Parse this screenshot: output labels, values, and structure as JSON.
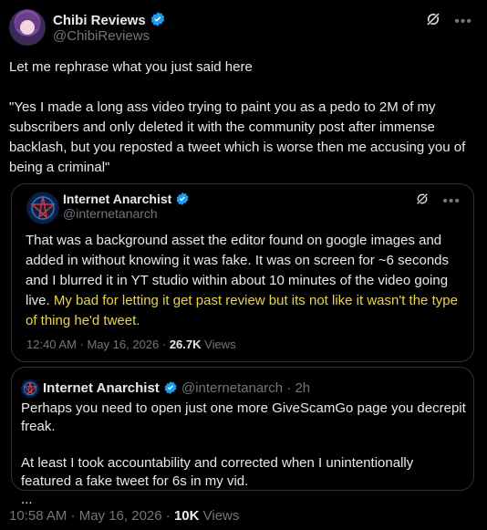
{
  "main_tweet": {
    "author_name": "Chibi Reviews",
    "author_handle": "@ChibiReviews",
    "text": "Let me rephrase what you just said here\n\n\"Yes I made a long ass video trying to paint you as a pedo to 2M of my subscribers and only deleted it with the community post after immense backlash, but you reposted a tweet which is worse then me accusing you of being a criminal\"",
    "time": "10:58 AM · May 16, 2026 · ",
    "views_count": "10K",
    "views_label": " Views"
  },
  "quoted_tweet": {
    "author_name": "Internet Anarchist",
    "author_handle": "@internetanarch",
    "text_normal": "That was a background asset the editor found on google images and added in without knowing it was fake. It was on screen for ~6 seconds and I blurred it in YT studio within about 10 minutes of the video going live. ",
    "text_highlight": "My bad for letting it get past review but its not like it wasn't the type of thing he'd tweet.",
    "time": "12:40 AM · May 16, 2026 · ",
    "views_count": "26.7K",
    "views_label": " Views"
  },
  "reply_tweet": {
    "author_name": "Internet Anarchist",
    "author_handle": "@internetanarch",
    "age": " · 2h",
    "text": "Perhaps you need to open just one more GiveScamGo page you decrepit freak.\n\nAt least I took accountability and corrected when I unintentionally featured a fake tweet for 6s in my vid.\n..."
  },
  "colors": {
    "background": "#000000",
    "text": "#e7e9ea",
    "muted": "#71767b",
    "verified": "#1d9bf0",
    "highlight": "#e8d44d",
    "border": "#2f3336"
  },
  "icons": {
    "verified": "verified-badge-icon",
    "grok": "grok-icon",
    "more": "more-icon"
  }
}
